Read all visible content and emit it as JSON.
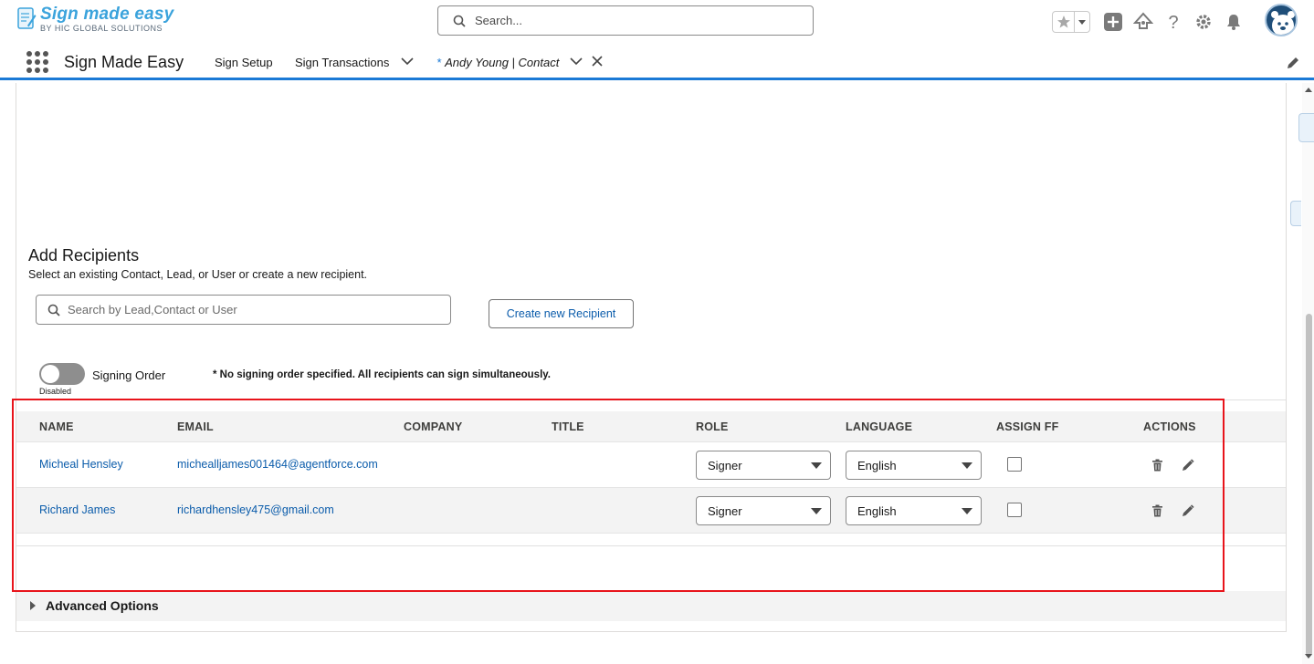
{
  "header": {
    "logo_main": "Sign made easy",
    "logo_sub": "BY HIC GLOBAL SOLUTIONS",
    "search_placeholder": "Search...",
    "icons": [
      "star-icon",
      "chevron-down-icon",
      "plus-icon",
      "trailhead-icon",
      "help-icon",
      "gear-icon",
      "bell-icon",
      "avatar"
    ]
  },
  "nav": {
    "app_name": "Sign Made Easy",
    "items": [
      "Sign Setup",
      "Sign Transactions"
    ],
    "active_tab_prefix": "*",
    "active_tab": "Andy Young | Contact"
  },
  "recipients": {
    "title": "Add Recipients",
    "subtitle": "Select an existing Contact, Lead, or User or create a new recipient.",
    "search_placeholder": "Search by Lead,Contact or User",
    "create_button": "Create new Recipient",
    "signing_order_label": "Signing Order",
    "signing_order_state": "Disabled",
    "signing_note": "* No signing order specified. All recipients can sign simultaneously.",
    "columns": [
      "NAME",
      "EMAIL",
      "COMPANY",
      "TITLE",
      "ROLE",
      "LANGUAGE",
      "ASSIGN FF",
      "ACTIONS"
    ],
    "rows": [
      {
        "name": "Micheal Hensley",
        "email": "michealljames001464@agentforce.com",
        "company": "",
        "title": "",
        "role": "Signer",
        "language": "English",
        "assign_ff": false
      },
      {
        "name": "Richard James",
        "email": "richardhensley475@gmail.com",
        "company": "",
        "title": "",
        "role": "Signer",
        "language": "English",
        "assign_ff": false
      }
    ]
  },
  "advanced": {
    "label": "Advanced Options"
  },
  "colors": {
    "brand_blue": "#1b7ad6",
    "link_blue": "#0b5cab",
    "highlight_red": "#e8141b"
  }
}
